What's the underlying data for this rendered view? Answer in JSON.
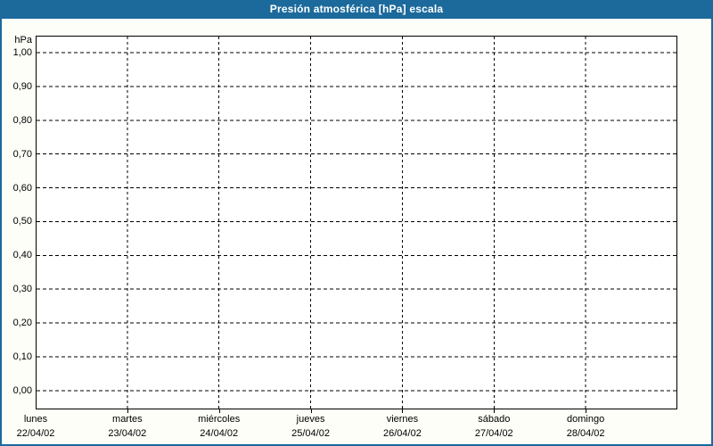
{
  "title_bar": {
    "title": "Presión atmosférica [hPa] escala"
  },
  "chart_data": {
    "type": "line",
    "title": "Presión atmosférica [hPa] escala",
    "subtitle": "",
    "ylabel": "hPa",
    "y_axis": {
      "unit": "hPa",
      "min": 0.0,
      "max": 1.0,
      "step": 0.1,
      "tick_labels": [
        "1,00",
        "0,90",
        "0,80",
        "0,70",
        "0,60",
        "0,50",
        "0,40",
        "0,30",
        "0,20",
        "0,10",
        "0,00"
      ]
    },
    "x_axis": {
      "categories": [
        {
          "day": "lunes",
          "date": "22/04/02"
        },
        {
          "day": "martes",
          "date": "23/04/02"
        },
        {
          "day": "miércoles",
          "date": "24/04/02"
        },
        {
          "day": "jueves",
          "date": "25/04/02"
        },
        {
          "day": "viernes",
          "date": "26/04/02"
        },
        {
          "day": "sábado",
          "date": "27/04/02"
        },
        {
          "day": "domingo",
          "date": "28/04/02"
        }
      ]
    },
    "series": [],
    "grid": "dashed",
    "legend": "none"
  },
  "colors": {
    "frame_blue": "#1C6A9C",
    "background": "#FCFEF7",
    "plot_background": "#FFFFFF",
    "grid": "#000000",
    "text": "#000000",
    "title_text": "#FFFFFF"
  }
}
